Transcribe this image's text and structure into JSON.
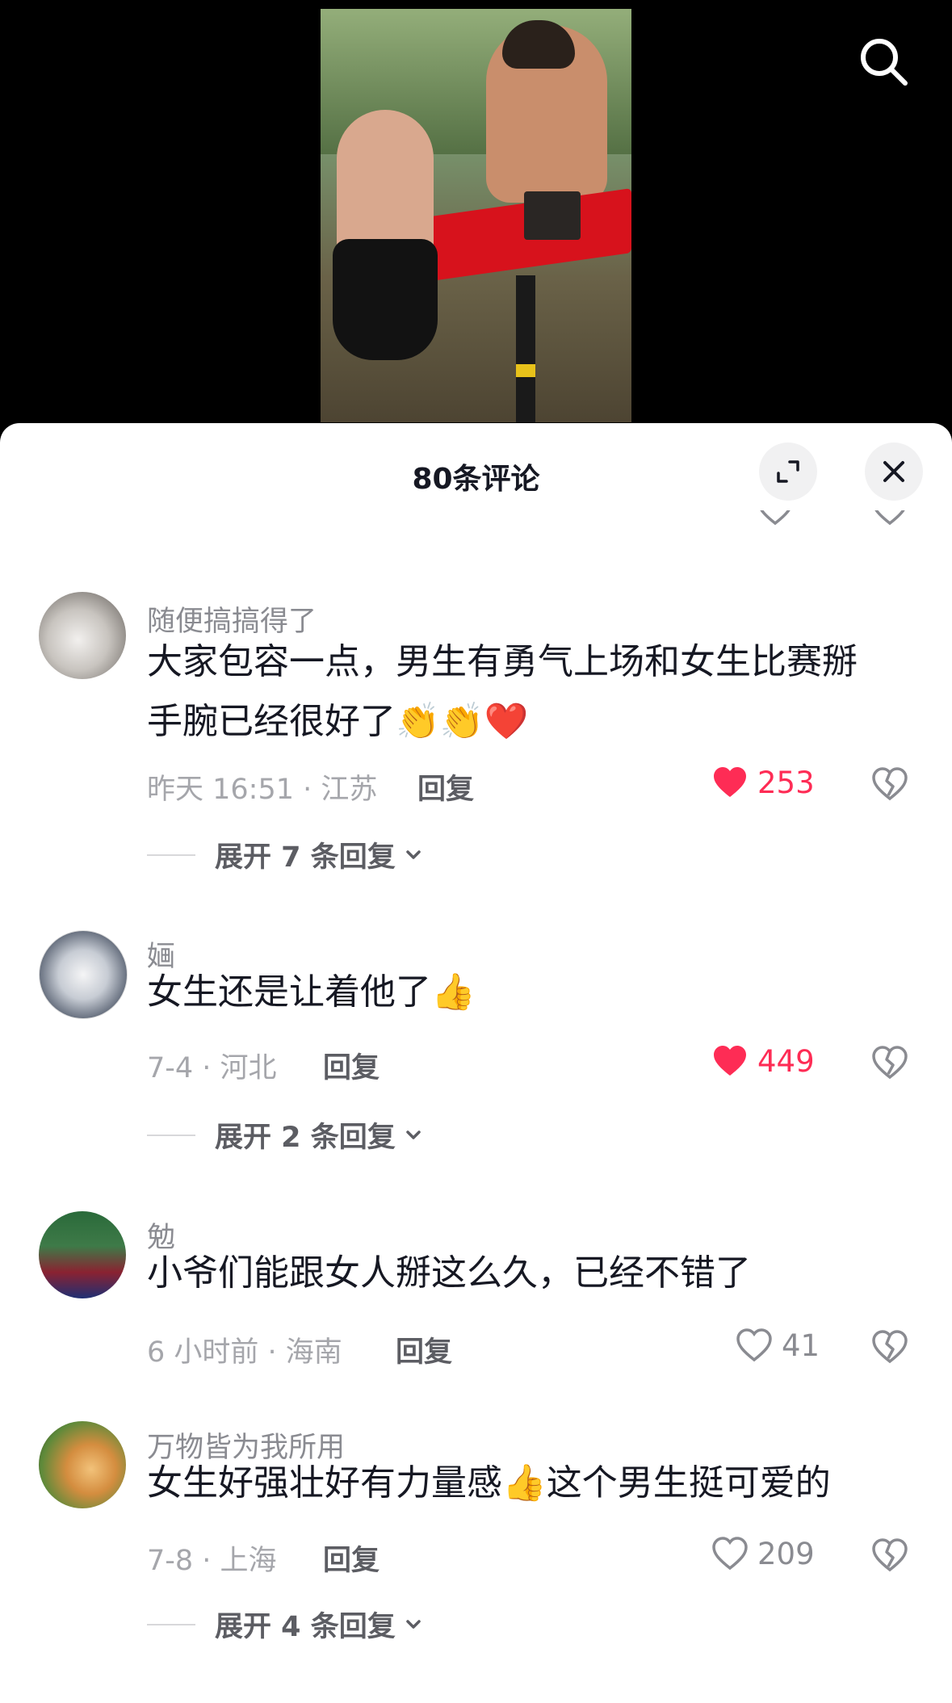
{
  "header": {
    "title": "80条评论"
  },
  "icons": {
    "search": "search-icon",
    "expand": "expand-icon",
    "close": "close-icon",
    "like": "heart-icon",
    "dislike": "broken-heart-icon",
    "chevron": "chevron-down-icon"
  },
  "colors": {
    "like_active": "#fe2c55",
    "text_primary": "#161823",
    "text_secondary": "#8a8b91"
  },
  "comments": [
    {
      "username": "随便搞搞得了",
      "text": "大家包容一点，男生有勇气上场和女生比赛掰手腕已经很好了",
      "emojis": "👏👏❤️",
      "meta": "昨天 16:51 · 江苏",
      "reply_label": "回复",
      "likes": "253",
      "liked": true,
      "expand_label": "展开 7 条回复"
    },
    {
      "username": "婳",
      "text": "女生还是让着他了",
      "emojis": "👍",
      "meta": "7-4 · 河北",
      "reply_label": "回复",
      "likes": "449",
      "liked": true,
      "expand_label": "展开 2 条回复"
    },
    {
      "username": "勉",
      "text": "小爷们能跟女人掰这么久，已经不错了",
      "emojis": "",
      "meta": "6 小时前 · 海南",
      "reply_label": "回复",
      "likes": "41",
      "liked": false,
      "expand_label": ""
    },
    {
      "username": "万物皆为我所用",
      "text": "女生好强壮好有力量感",
      "emojis": "👍",
      "text_after": "这个男生挺可爱的",
      "meta": "7-8 · 上海",
      "reply_label": "回复",
      "likes": "209",
      "liked": false,
      "expand_label": "展开 4 条回复"
    }
  ]
}
